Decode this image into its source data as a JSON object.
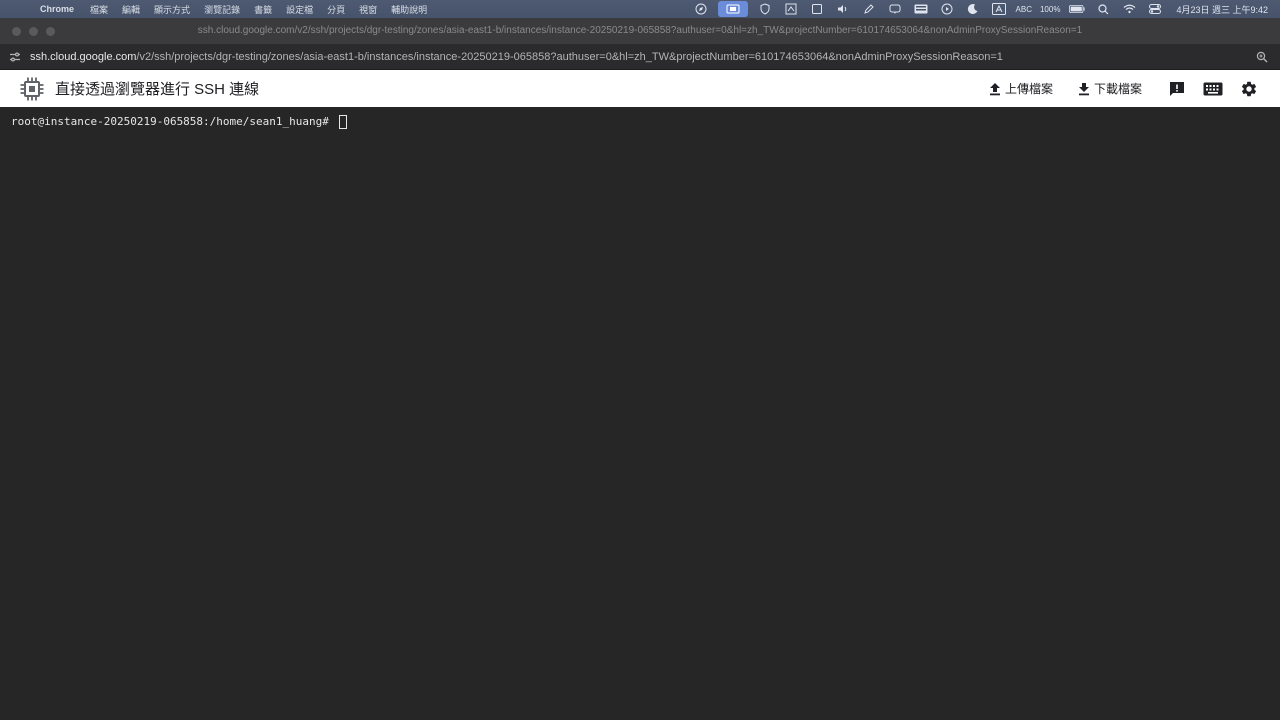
{
  "menubar": {
    "apple_glyph": "",
    "items": [
      "Chrome",
      "檔案",
      "編輯",
      "顯示方式",
      "瀏覽記錄",
      "書籤",
      "設定檔",
      "分頁",
      "視窗",
      "輔助說明"
    ],
    "status_text": {
      "abc": "ABC",
      "battery": "100%",
      "datetime": "4月23日 週三 上午9:42"
    }
  },
  "window": {
    "title": "ssh.cloud.google.com/v2/ssh/projects/dgr-testing/zones/asia-east1-b/instances/instance-20250219-065858?authuser=0&hl=zh_TW&projectNumber=610174653064&nonAdminProxySessionReason=1"
  },
  "address": {
    "host": "ssh.cloud.google.com",
    "path": "/v2/ssh/projects/dgr-testing/zones/asia-east1-b/instances/instance-20250219-065858?authuser=0&hl=zh_TW&projectNumber=610174653064&nonAdminProxySessionReason=1"
  },
  "header": {
    "title": "直接透過瀏覽器進行 SSH 連線",
    "upload_label": "上傳檔案",
    "download_label": "下載檔案"
  },
  "terminal": {
    "prompt": "root@instance-20250219-065858:/home/sean1_huang# "
  },
  "colors": {
    "terminal_bg": "#262626",
    "header_bg": "#ffffff",
    "menubar_bg": "#4a566e"
  }
}
